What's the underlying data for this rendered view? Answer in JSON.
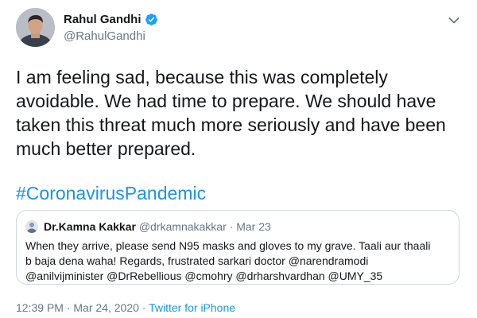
{
  "author": {
    "name": "Rahul Gandhi",
    "handle": "@RahulGandhi",
    "verified": true
  },
  "tweet": {
    "text": "I am feeling sad, because this was completely\navoidable. We had time to prepare. We should have\ntaken this threat much more seriously and have been\nmuch better prepared.",
    "hashtag": "#CoronavirusPandemic"
  },
  "quote": {
    "name": "Dr.Kamna Kakkar",
    "handle": "@drkamnakakkar",
    "separator": "·",
    "date": "Mar 23",
    "text": "When they arrive, please send N95 masks and gloves to my grave. Taali aur thaali\nb baja dena waha! Regards, frustrated sarkari doctor @narendramodi\n@anilvijminister @DrRebellious @cmohry @drharshvardhan @UMY_35"
  },
  "meta": {
    "time": "12:39 PM",
    "separator": "·",
    "date": "Mar 24, 2020",
    "source": "Twitter for iPhone"
  },
  "colors": {
    "accent": "#1b95e0",
    "verified": "#1da1f2",
    "secondary_text": "#657786",
    "border": "#ccd6dd"
  },
  "icons": {
    "verified": "verified-badge-icon",
    "more": "chevron-down-icon"
  }
}
